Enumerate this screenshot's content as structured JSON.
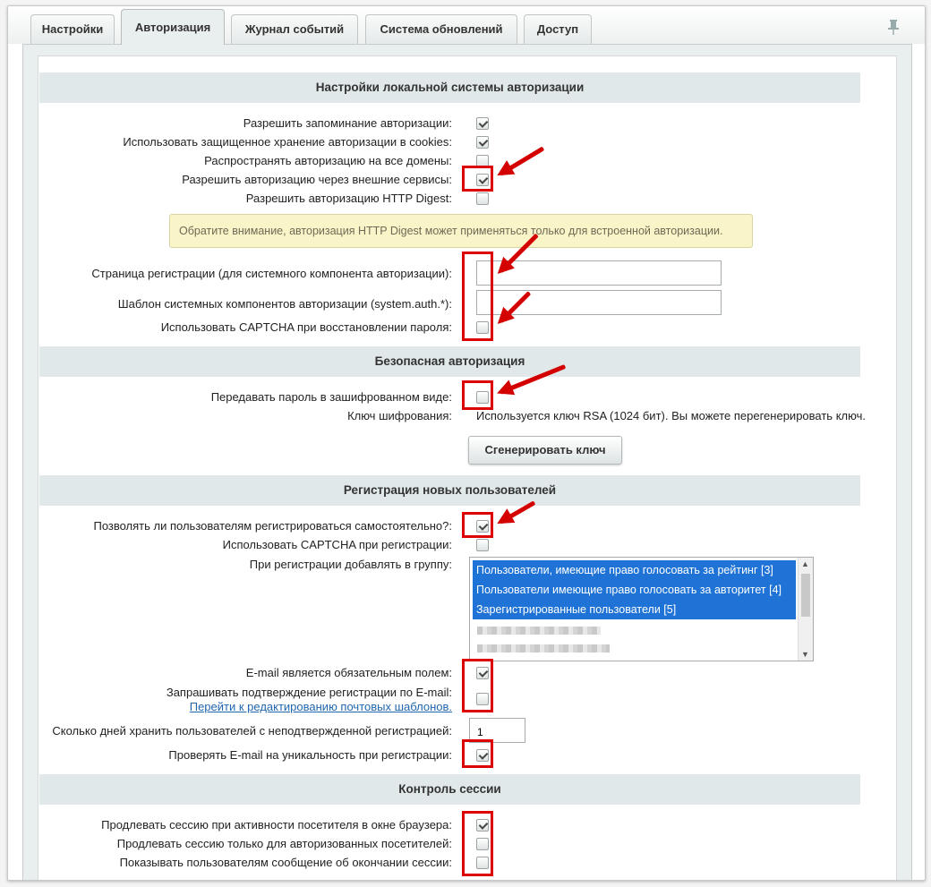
{
  "tabs": [
    "Настройки",
    "Авторизация",
    "Журнал событий",
    "Система обновлений",
    "Доступ"
  ],
  "active_tab": "Авторизация",
  "sections": {
    "local": "Настройки локальной системы авторизации",
    "secure": "Безопасная авторизация",
    "register": "Регистрация новых пользователей",
    "session": "Контроль сессии"
  },
  "local": {
    "remember_label": "Разрешить запоминание авторизации:",
    "remember_checked": true,
    "secure_cookies_label": "Использовать защищенное хранение авторизации в cookies:",
    "secure_cookies_checked": true,
    "all_domains_label": "Распространять авторизацию на все домены:",
    "all_domains_checked": false,
    "external_label": "Разрешить авторизацию через внешние сервисы:",
    "external_checked": true,
    "http_digest_label": "Разрешить авторизацию HTTP Digest:",
    "http_digest_checked": false,
    "note": "Обратите внимание, авторизация HTTP Digest может применяться только для встроенной авторизации.",
    "reg_page_label": "Страница регистрации (для системного компонента авторизации):",
    "reg_page_value": "",
    "template_label": "Шаблон системных компонентов авторизации (system.auth.*):",
    "template_value": "",
    "captcha_restore_label": "Использовать CAPTCHA при восстановлении пароля:",
    "captcha_restore_checked": false
  },
  "secure": {
    "encrypted_label": "Передавать пароль в зашифрованном виде:",
    "encrypted_checked": false,
    "key_label": "Ключ шифрования:",
    "key_info": "Используется ключ RSA (1024 бит). Вы можете перегенерировать ключ.",
    "generate_button": "Сгенерировать ключ"
  },
  "register": {
    "self_reg_label": "Позволять ли пользователям регистрироваться самостоятельно?:",
    "self_reg_checked": true,
    "captcha_reg_label": "Использовать CAPTCHA при регистрации:",
    "captcha_reg_checked": false,
    "group_label": "При регистрации добавлять в группу:",
    "groups": [
      {
        "label": "Пользователи, имеющие право голосовать за рейтинг [3]",
        "selected": true
      },
      {
        "label": "Пользователи имеющие право голосовать за авторитет [4]",
        "selected": true
      },
      {
        "label": "Зарегистрированные пользователи [5]",
        "selected": true
      }
    ],
    "email_required_label": "E-mail является обязательным полем:",
    "email_required_checked": true,
    "email_confirm_label": "Запрашивать подтверждение регистрации по E-mail:",
    "email_confirm_checked": false,
    "email_templates_link": "Перейти к редактированию почтовых шаблонов.",
    "unconfirmed_days_label": "Сколько дней хранить пользователей с неподтвержденной регистрацией:",
    "unconfirmed_days_value": "1",
    "email_unique_label": "Проверять E-mail на уникальность при регистрации:",
    "email_unique_checked": true
  },
  "session": {
    "extend_activity_label": "Продлевать сессию при активности посетителя в окне браузера:",
    "extend_activity_checked": true,
    "extend_auth_label": "Продлевать сессию только для авторизованных посетителей:",
    "extend_auth_checked": false,
    "show_end_msg_label": "Показывать пользователям сообщение об окончании сессии:",
    "show_end_msg_checked": false
  },
  "colors": {
    "highlight": "#dd0000",
    "selection": "#1f73d6",
    "note_bg": "#faf5c9",
    "link": "#2067b0"
  }
}
